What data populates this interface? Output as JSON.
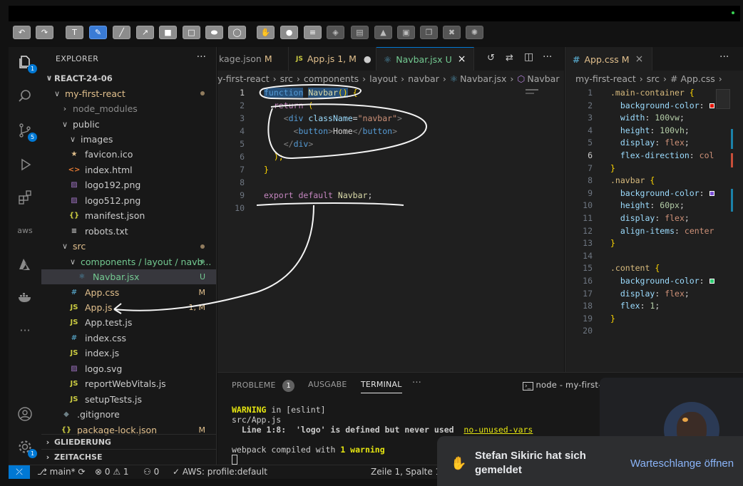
{
  "annotation_toolbar": {
    "tools": [
      "undo-icon",
      "redo-icon",
      "text-icon",
      "pen-icon",
      "line-icon",
      "arrow-icon",
      "filled-rect-icon",
      "rect-icon",
      "filled-ellipse-icon",
      "ellipse-icon",
      "hand-icon",
      "drop-icon",
      "lines-icon",
      "layers-icon",
      "align-icon",
      "mountain-icon",
      "clipboard-icon",
      "copy-icon",
      "trash-icon",
      "settings-icon"
    ]
  },
  "activity_bar": {
    "explorer_badge": "1",
    "scm_badge": "5",
    "aws_label": "aws",
    "settings_badge": "1"
  },
  "explorer": {
    "title": "EXPLORER",
    "more": "···",
    "root": "REACT-24-06",
    "items": [
      {
        "label": "my-first-react",
        "indent": 1,
        "chev": "v",
        "type": "folder",
        "dot": true,
        "color": "#e2c08d"
      },
      {
        "label": "node_modules",
        "indent": 2,
        "chev": ">",
        "type": "folder",
        "color": "#8c8c8c"
      },
      {
        "label": "public",
        "indent": 2,
        "chev": "v",
        "type": "folder",
        "color": "#cccccc"
      },
      {
        "label": "images",
        "indent": 3,
        "chev": "v",
        "type": "folder",
        "color": "#cccccc"
      },
      {
        "label": "favicon.ico",
        "indent": 3,
        "icon": "★",
        "icolor": "#e2c08d",
        "color": "#cccccc"
      },
      {
        "label": "index.html",
        "indent": 3,
        "icon": "<>",
        "icolor": "#e37933",
        "color": "#cccccc"
      },
      {
        "label": "logo192.png",
        "indent": 3,
        "icon": "▨",
        "icolor": "#a074c4",
        "color": "#cccccc"
      },
      {
        "label": "logo512.png",
        "indent": 3,
        "icon": "▨",
        "icolor": "#a074c4",
        "color": "#cccccc"
      },
      {
        "label": "manifest.json",
        "indent": 3,
        "icon": "{}",
        "icolor": "#cbcb41",
        "color": "#cccccc"
      },
      {
        "label": "robots.txt",
        "indent": 3,
        "icon": "≡",
        "icolor": "#cccccc",
        "color": "#cccccc"
      },
      {
        "label": "src",
        "indent": 2,
        "chev": "v",
        "type": "folder",
        "dot": true,
        "color": "#e2c08d"
      },
      {
        "label": "components / layout / navb...",
        "indent": 3,
        "chev": "v",
        "type": "folder",
        "dot": true,
        "dotc": "#73c991",
        "color": "#73c991"
      },
      {
        "label": "Navbar.jsx",
        "indent": 4,
        "icon": "⚛",
        "icolor": "#519aba",
        "color": "#73c991",
        "badge": "U",
        "bcolor": "#73c991",
        "selected": true
      },
      {
        "label": "App.css",
        "indent": 3,
        "icon": "#",
        "icolor": "#519aba",
        "color": "#e2c08d",
        "badge": "M",
        "bcolor": "#e2c08d"
      },
      {
        "label": "App.js",
        "indent": 3,
        "icon": "JS",
        "icolor": "#cbcb41",
        "color": "#e2c08d",
        "badge": "1, M",
        "bcolor": "#e2c08d"
      },
      {
        "label": "App.test.js",
        "indent": 3,
        "icon": "JS",
        "icolor": "#cbcb41",
        "color": "#cccccc"
      },
      {
        "label": "index.css",
        "indent": 3,
        "icon": "#",
        "icolor": "#519aba",
        "color": "#cccccc"
      },
      {
        "label": "index.js",
        "indent": 3,
        "icon": "JS",
        "icolor": "#cbcb41",
        "color": "#cccccc"
      },
      {
        "label": "logo.svg",
        "indent": 3,
        "icon": "▨",
        "icolor": "#a074c4",
        "color": "#cccccc"
      },
      {
        "label": "reportWebVitals.js",
        "indent": 3,
        "icon": "JS",
        "icolor": "#cbcb41",
        "color": "#cccccc"
      },
      {
        "label": "setupTests.js",
        "indent": 3,
        "icon": "JS",
        "icolor": "#cbcb41",
        "color": "#cccccc"
      },
      {
        "label": ".gitignore",
        "indent": 2,
        "icon": "◆",
        "icolor": "#6d8086",
        "color": "#cccccc"
      },
      {
        "label": "package-lock.json",
        "indent": 2,
        "icon": "{}",
        "icolor": "#cbcb41",
        "color": "#e2c08d",
        "badge": "M",
        "bcolor": "#e2c08d"
      }
    ],
    "outline": "GLIEDERUNG",
    "timeline": "ZEITACHSE"
  },
  "editor1": {
    "tabs": [
      {
        "label": "kage.json",
        "suffix": "M",
        "icon": "",
        "scolor": "#e2c08d"
      },
      {
        "label": "App.js",
        "suffix": "1, M",
        "icon": "JS",
        "scolor": "#e2c08d",
        "modified": "●"
      },
      {
        "label": "Navbar.jsx",
        "suffix": "U",
        "icon": "⚛",
        "scolor": "#73c991",
        "close": "×",
        "active": true
      }
    ],
    "breadcrumbs": [
      "y-first-react",
      "src",
      "components",
      "layout",
      "navbar",
      "Navbar.jsx",
      "Navbar"
    ],
    "line_numbers": [
      "1",
      "2",
      "3",
      "4",
      "5",
      "6",
      "7",
      "8",
      "9",
      "10"
    ],
    "current_line": "1"
  },
  "editor2": {
    "tab_label": "App.css",
    "tab_suffix": "M",
    "tab_close": "×",
    "breadcrumbs": [
      "my-first-react",
      "src",
      "# App.css"
    ],
    "line_numbers": [
      "1",
      "2",
      "3",
      "4",
      "5",
      "6",
      "7",
      "8",
      "9",
      "10",
      "11",
      "12",
      "13",
      "14",
      "15",
      "16",
      "17",
      "18",
      "19",
      "20"
    ],
    "current_line": "6"
  },
  "panel": {
    "tabs": [
      "PROBLEME",
      "AUSGABE",
      "TERMINAL",
      "···"
    ],
    "problems_count": "1",
    "terminal_label": "node - my-first-re",
    "lines": {
      "warning_word": "WARNING",
      "warning_rest": " in [eslint]",
      "file": "src/App.js",
      "detail": "  Line 1:8:  'logo' is defined but never used  ",
      "rule": "no-unused-vars",
      "compiled_pre": "webpack compiled with ",
      "compiled_bold": "1 warning"
    }
  },
  "status": {
    "branch": "main*",
    "errors": "0",
    "warnings": "1",
    "ports": "0",
    "aws": "AWS: profile:default",
    "position": "Zeile 1, Spalte 17"
  },
  "toast": {
    "name": "Stefan Sikiric hat sich gemeldet",
    "action": "Warteschlange öffnen"
  }
}
